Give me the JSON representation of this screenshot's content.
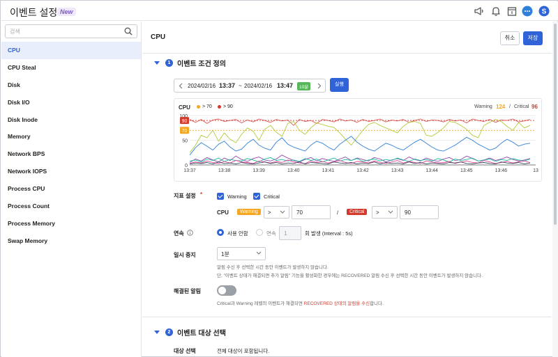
{
  "app": {
    "title": "이벤트 설정",
    "badge": "New"
  },
  "search": {
    "placeholder": "검색"
  },
  "sidebar": {
    "items": [
      {
        "label": "CPU",
        "active": true
      },
      {
        "label": "CPU Steal"
      },
      {
        "label": "Disk"
      },
      {
        "label": "Disk I/O"
      },
      {
        "label": "Disk Inode"
      },
      {
        "label": "Memory"
      },
      {
        "label": "Network BPS"
      },
      {
        "label": "Network IOPS"
      },
      {
        "label": "Process CPU"
      },
      {
        "label": "Process Count"
      },
      {
        "label": "Process Memory"
      },
      {
        "label": "Swap Memory"
      }
    ]
  },
  "main": {
    "title": "CPU",
    "cancel_label": "취소",
    "save_label": "저장",
    "section1": {
      "number": "1",
      "title": "이벤트 조건 정의"
    },
    "section2": {
      "number": "2",
      "title": "이벤트 대상 선택"
    },
    "range": {
      "start_date": "2024/02/16",
      "start_time": "13:37",
      "sep": "~",
      "end_date": "2024/02/16",
      "end_time": "13:47",
      "duration": "10분",
      "run_label": "실행"
    },
    "metric": {
      "label": "지표 설정",
      "required": "*",
      "warning_label": "Warning",
      "critical_label": "Critical",
      "row_label": "CPU",
      "warning_tag": "Warning",
      "warning_op": ">",
      "warning_value": "70",
      "slash": "/",
      "critical_tag": "Critical",
      "critical_op": ">",
      "critical_value": "90"
    },
    "consecutive": {
      "label": "연속",
      "off_label": "사용 안함",
      "on_label": "연속",
      "count": "1",
      "suffix": "회 발생 (Interval : 5s)"
    },
    "pause": {
      "label": "일시 중지",
      "value": "1분",
      "help1": "알림 수신 후 선택한 시간 동안 이벤트가 발생하지 않습니다.",
      "help2": "단, \"이벤트 상태가 해결되면 추가 알림\" 기능을 활성화한 경우에는 RECOVERED 알림 수신 후 선택한 시간 동안 이벤트가 발생하지 않습니다."
    },
    "resolved": {
      "label": "해결된 알림",
      "help_pre": "Critical과 Warning 레벨의 이벤트가 해결되면 ",
      "help_red": "RECOVERED 상태의 알림을 수신",
      "help_post": "합니다."
    },
    "target": {
      "label": "대상 선택",
      "value": "전체 대상이 포함됩니다."
    }
  },
  "chart_data": {
    "type": "line",
    "title": "CPU",
    "legend": [
      {
        "label": "> 70",
        "color": "#f5a623"
      },
      {
        "label": "> 90",
        "color": "#d33a2c"
      }
    ],
    "summary": {
      "warning_label": "Warning",
      "warning_count": "124",
      "sep": "/",
      "critical_label": "Critical",
      "critical_count": "96"
    },
    "thresholds": [
      {
        "label": "90",
        "value": 90,
        "color": "#d33a2c"
      },
      {
        "label": "70",
        "value": 70,
        "color": "#f5a623"
      }
    ],
    "y_ticks": [
      "100",
      "50",
      "0"
    ],
    "ylim": [
      0,
      100
    ],
    "x_ticks": [
      "13:37",
      "13:38",
      "13:39",
      "13:40",
      "13:41",
      "13:42",
      "13:43",
      "13:44",
      "13:45",
      "13:46",
      "13"
    ],
    "series": [
      {
        "color": "#d9534f",
        "values": [
          92,
          86,
          92,
          84,
          91,
          93,
          88,
          90,
          92,
          85,
          91,
          87,
          93,
          90,
          86,
          92,
          89,
          91,
          80,
          92,
          88,
          90,
          84,
          92,
          90,
          87,
          93,
          89,
          91,
          86,
          92,
          88,
          90,
          93,
          87,
          91,
          89,
          92,
          86,
          90,
          93,
          88,
          91,
          90,
          87,
          92,
          89,
          91,
          85,
          93,
          90,
          88,
          92,
          86,
          91,
          90,
          93,
          87,
          89,
          92
        ]
      },
      {
        "color": "#b6c93a",
        "values": [
          25,
          40,
          60,
          55,
          70,
          48,
          65,
          52,
          45,
          62,
          75,
          68,
          50,
          72,
          80,
          66,
          58,
          84,
          88,
          70,
          62,
          75,
          85,
          82,
          78,
          76,
          65,
          52,
          40,
          55,
          70,
          82,
          86,
          80,
          75,
          70,
          65,
          78,
          86,
          88,
          84,
          60,
          58,
          66,
          75,
          88,
          86,
          80,
          72,
          60,
          55,
          80,
          86,
          92,
          88,
          78,
          70,
          86,
          75,
          80
        ]
      },
      {
        "color": "#2f80d8",
        "values": [
          20,
          35,
          45,
          38,
          30,
          42,
          48,
          36,
          28,
          32,
          44,
          52,
          40,
          34,
          30,
          46,
          55,
          42,
          36,
          32,
          28,
          40,
          48,
          44,
          36,
          30,
          42,
          50,
          58,
          46,
          38,
          32,
          28,
          36,
          44,
          40,
          34,
          30,
          38,
          46,
          52,
          44,
          36,
          30,
          28,
          34,
          40,
          48,
          56,
          50,
          42,
          36,
          30,
          34,
          44,
          52,
          46,
          38,
          42,
          44
        ]
      },
      {
        "color": "#8e44ad",
        "values": [
          5,
          12,
          8,
          15,
          10,
          6,
          14,
          9,
          18,
          11,
          7,
          13,
          16,
          10,
          8,
          12,
          20,
          14,
          9,
          6,
          11,
          15,
          8,
          13,
          10,
          7,
          12,
          16,
          9,
          14,
          11,
          8,
          15,
          12,
          6,
          10,
          13,
          9,
          16,
          11,
          8,
          14,
          10,
          7,
          12,
          15,
          9,
          11,
          18,
          13,
          8,
          10,
          14,
          9,
          12,
          16,
          11,
          8,
          10,
          13
        ]
      },
      {
        "color": "#1abc9c",
        "values": [
          8,
          10,
          6,
          12,
          9,
          14,
          7,
          11,
          9,
          8,
          13,
          10,
          6,
          12,
          15,
          9,
          11,
          8,
          10,
          7,
          13,
          9,
          12,
          6,
          10,
          14,
          8,
          11,
          9,
          13,
          7,
          10,
          12,
          8,
          11,
          9,
          14,
          10,
          7,
          12,
          9,
          11,
          8,
          13,
          10,
          6,
          12,
          9,
          11,
          14,
          8,
          10,
          12,
          7,
          11,
          9,
          13,
          10,
          8,
          12
        ]
      },
      {
        "color": "#e84393",
        "values": [
          3,
          6,
          4,
          8,
          5,
          3,
          7,
          4,
          9,
          6,
          5,
          3,
          8,
          6,
          4,
          7,
          5,
          10,
          6,
          4,
          3,
          8,
          5,
          7,
          4,
          6,
          9,
          5,
          3,
          7,
          6,
          4,
          8,
          5,
          3,
          6,
          9,
          4,
          7,
          5,
          3,
          8,
          6,
          4,
          5,
          7,
          3,
          6,
          8,
          5,
          4,
          9,
          6,
          3,
          5,
          7,
          4,
          6,
          8,
          5
        ]
      },
      {
        "color": "#34495e",
        "values": [
          2,
          4,
          3,
          5,
          2,
          6,
          3,
          4,
          2,
          5,
          3,
          2,
          4,
          6,
          3,
          5,
          2,
          4,
          3,
          6,
          2,
          5,
          4,
          3,
          2,
          6,
          4,
          3,
          5,
          2,
          4,
          3,
          6,
          2,
          5,
          3,
          4,
          2,
          6,
          3,
          5,
          2,
          4,
          3,
          2,
          5,
          4,
          6,
          3,
          2,
          4,
          5,
          3,
          2,
          6,
          4,
          3,
          5,
          2,
          4
        ]
      }
    ]
  }
}
